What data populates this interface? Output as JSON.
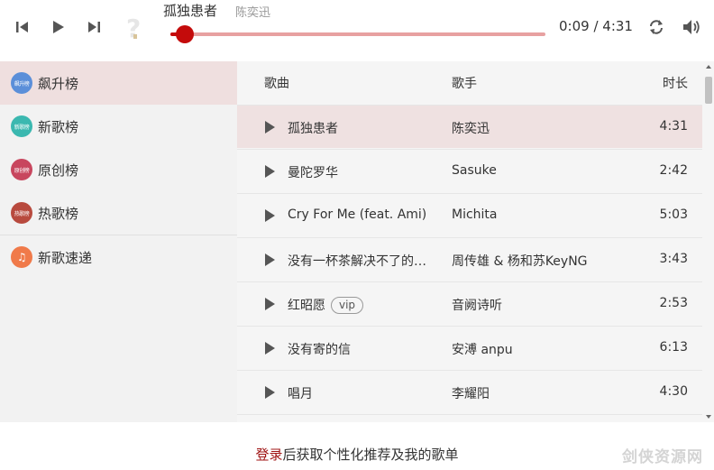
{
  "player": {
    "title": "孤独患者",
    "artist": "陈奕迅",
    "time": "0:09 / 4:31",
    "progress_fraction": 0.03,
    "icons": {
      "previous": "skip-previous-icon",
      "play": "play-icon",
      "next": "skip-next-icon",
      "cover": "unknown-cover-icon",
      "loop": "loop-icon",
      "volume": "volume-icon"
    }
  },
  "sidebar": {
    "items": [
      {
        "label": "飙升榜",
        "badge_text": "飙升榜",
        "badge_color": "#5b8fd9",
        "active": true
      },
      {
        "label": "新歌榜",
        "badge_text": "新歌榜",
        "badge_color": "#3bb8b0",
        "active": false
      },
      {
        "label": "原创榜",
        "badge_text": "原创榜",
        "badge_color": "#c8465e",
        "active": false
      },
      {
        "label": "热歌榜",
        "badge_text": "热歌榜",
        "badge_color": "#b84a3e",
        "active": false
      },
      {
        "label": "新歌速递",
        "badge_text": "♫",
        "badge_color": "#f07a4a",
        "active": false
      }
    ]
  },
  "table": {
    "headers": {
      "song": "歌曲",
      "artist": "歌手",
      "duration": "时长"
    },
    "rows": [
      {
        "name": "孤独患者",
        "vip": "",
        "artist": "陈奕迅",
        "duration": "4:31",
        "playing": true
      },
      {
        "name": "曼陀罗华",
        "vip": "",
        "artist": "Sasuke",
        "duration": "2:42",
        "playing": false
      },
      {
        "name": "Cry For Me (feat. Ami)",
        "vip": "",
        "artist": "Michita",
        "duration": "5:03",
        "playing": false
      },
      {
        "name": "没有一杯茶解决不了的…",
        "vip": "",
        "artist": "周传雄 & 杨和苏KeyNG",
        "duration": "3:43",
        "playing": false
      },
      {
        "name": "红昭愿",
        "vip": "vip",
        "artist": "音阙诗听",
        "duration": "2:53",
        "playing": false
      },
      {
        "name": "没有寄的信",
        "vip": "",
        "artist": "安溥 anpu",
        "duration": "6:13",
        "playing": false
      },
      {
        "name": "唱月",
        "vip": "",
        "artist": "李耀阳",
        "duration": "4:30",
        "playing": false
      }
    ]
  },
  "footer": {
    "login_link": "登录",
    "login_rest": "后获取个性化推荐及我的歌单",
    "watermark": "剑侠资源网"
  },
  "colors": {
    "accent": "#c40b0b",
    "track": "#e7a1a1",
    "active_bg": "#efdfdf",
    "sidebar_bg": "#f2f2f2"
  }
}
